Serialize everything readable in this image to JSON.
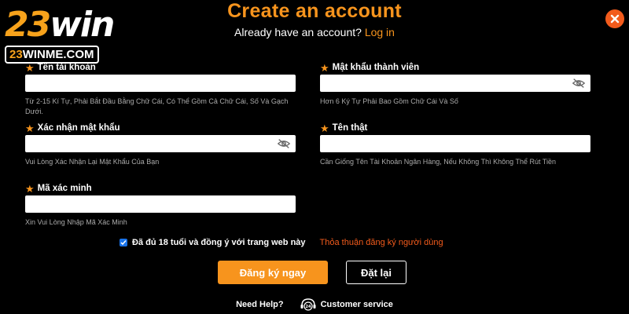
{
  "logo": {
    "num": "23",
    "word": "win",
    "domain_num": "23",
    "domain_rest": "WINME.COM"
  },
  "header": {
    "title": "Create an account",
    "subtitle": "Already have an account?",
    "login_link": "Log in"
  },
  "fields": {
    "username": {
      "label": "Tên tài khoản",
      "value": "",
      "hint": "Từ 2-15 Kí Tự, Phải Bắt Đầu Bằng Chữ Cái, Có Thể Gồm Cả Chữ Cái, Số Và Gạch Dưới."
    },
    "password": {
      "label": "Mật khẩu thành viên",
      "value": "",
      "hint": "Hơn 6 Ký Tự Phải Bao Gồm Chữ Cái Và Số"
    },
    "confirm_password": {
      "label": "Xác nhận mật khẩu",
      "value": "",
      "hint": "Vui Lòng Xác Nhận Lại Mật Khẩu Của Bạn"
    },
    "real_name": {
      "label": "Tên thật",
      "value": "",
      "hint": "Cần Giống Tên Tài Khoản Ngân Hàng, Nếu Không Thì Không Thể Rút Tiền"
    },
    "verification_code": {
      "label": "Mã xác minh",
      "value": "",
      "hint": "Xin Vui Lòng Nhập Mã Xác Minh"
    }
  },
  "agreement": {
    "checked": true,
    "text": "Đã đủ 18 tuổi và đồng ý với trang web này",
    "link": "Thỏa thuận đăng ký người dùng"
  },
  "buttons": {
    "register": "Đăng ký ngay",
    "reset": "Đặt lại"
  },
  "footer": {
    "help": "Need Help?",
    "customer_service": "Customer service"
  },
  "colors": {
    "accent": "#f7941d",
    "close": "#f25b1c",
    "background": "#000000"
  }
}
